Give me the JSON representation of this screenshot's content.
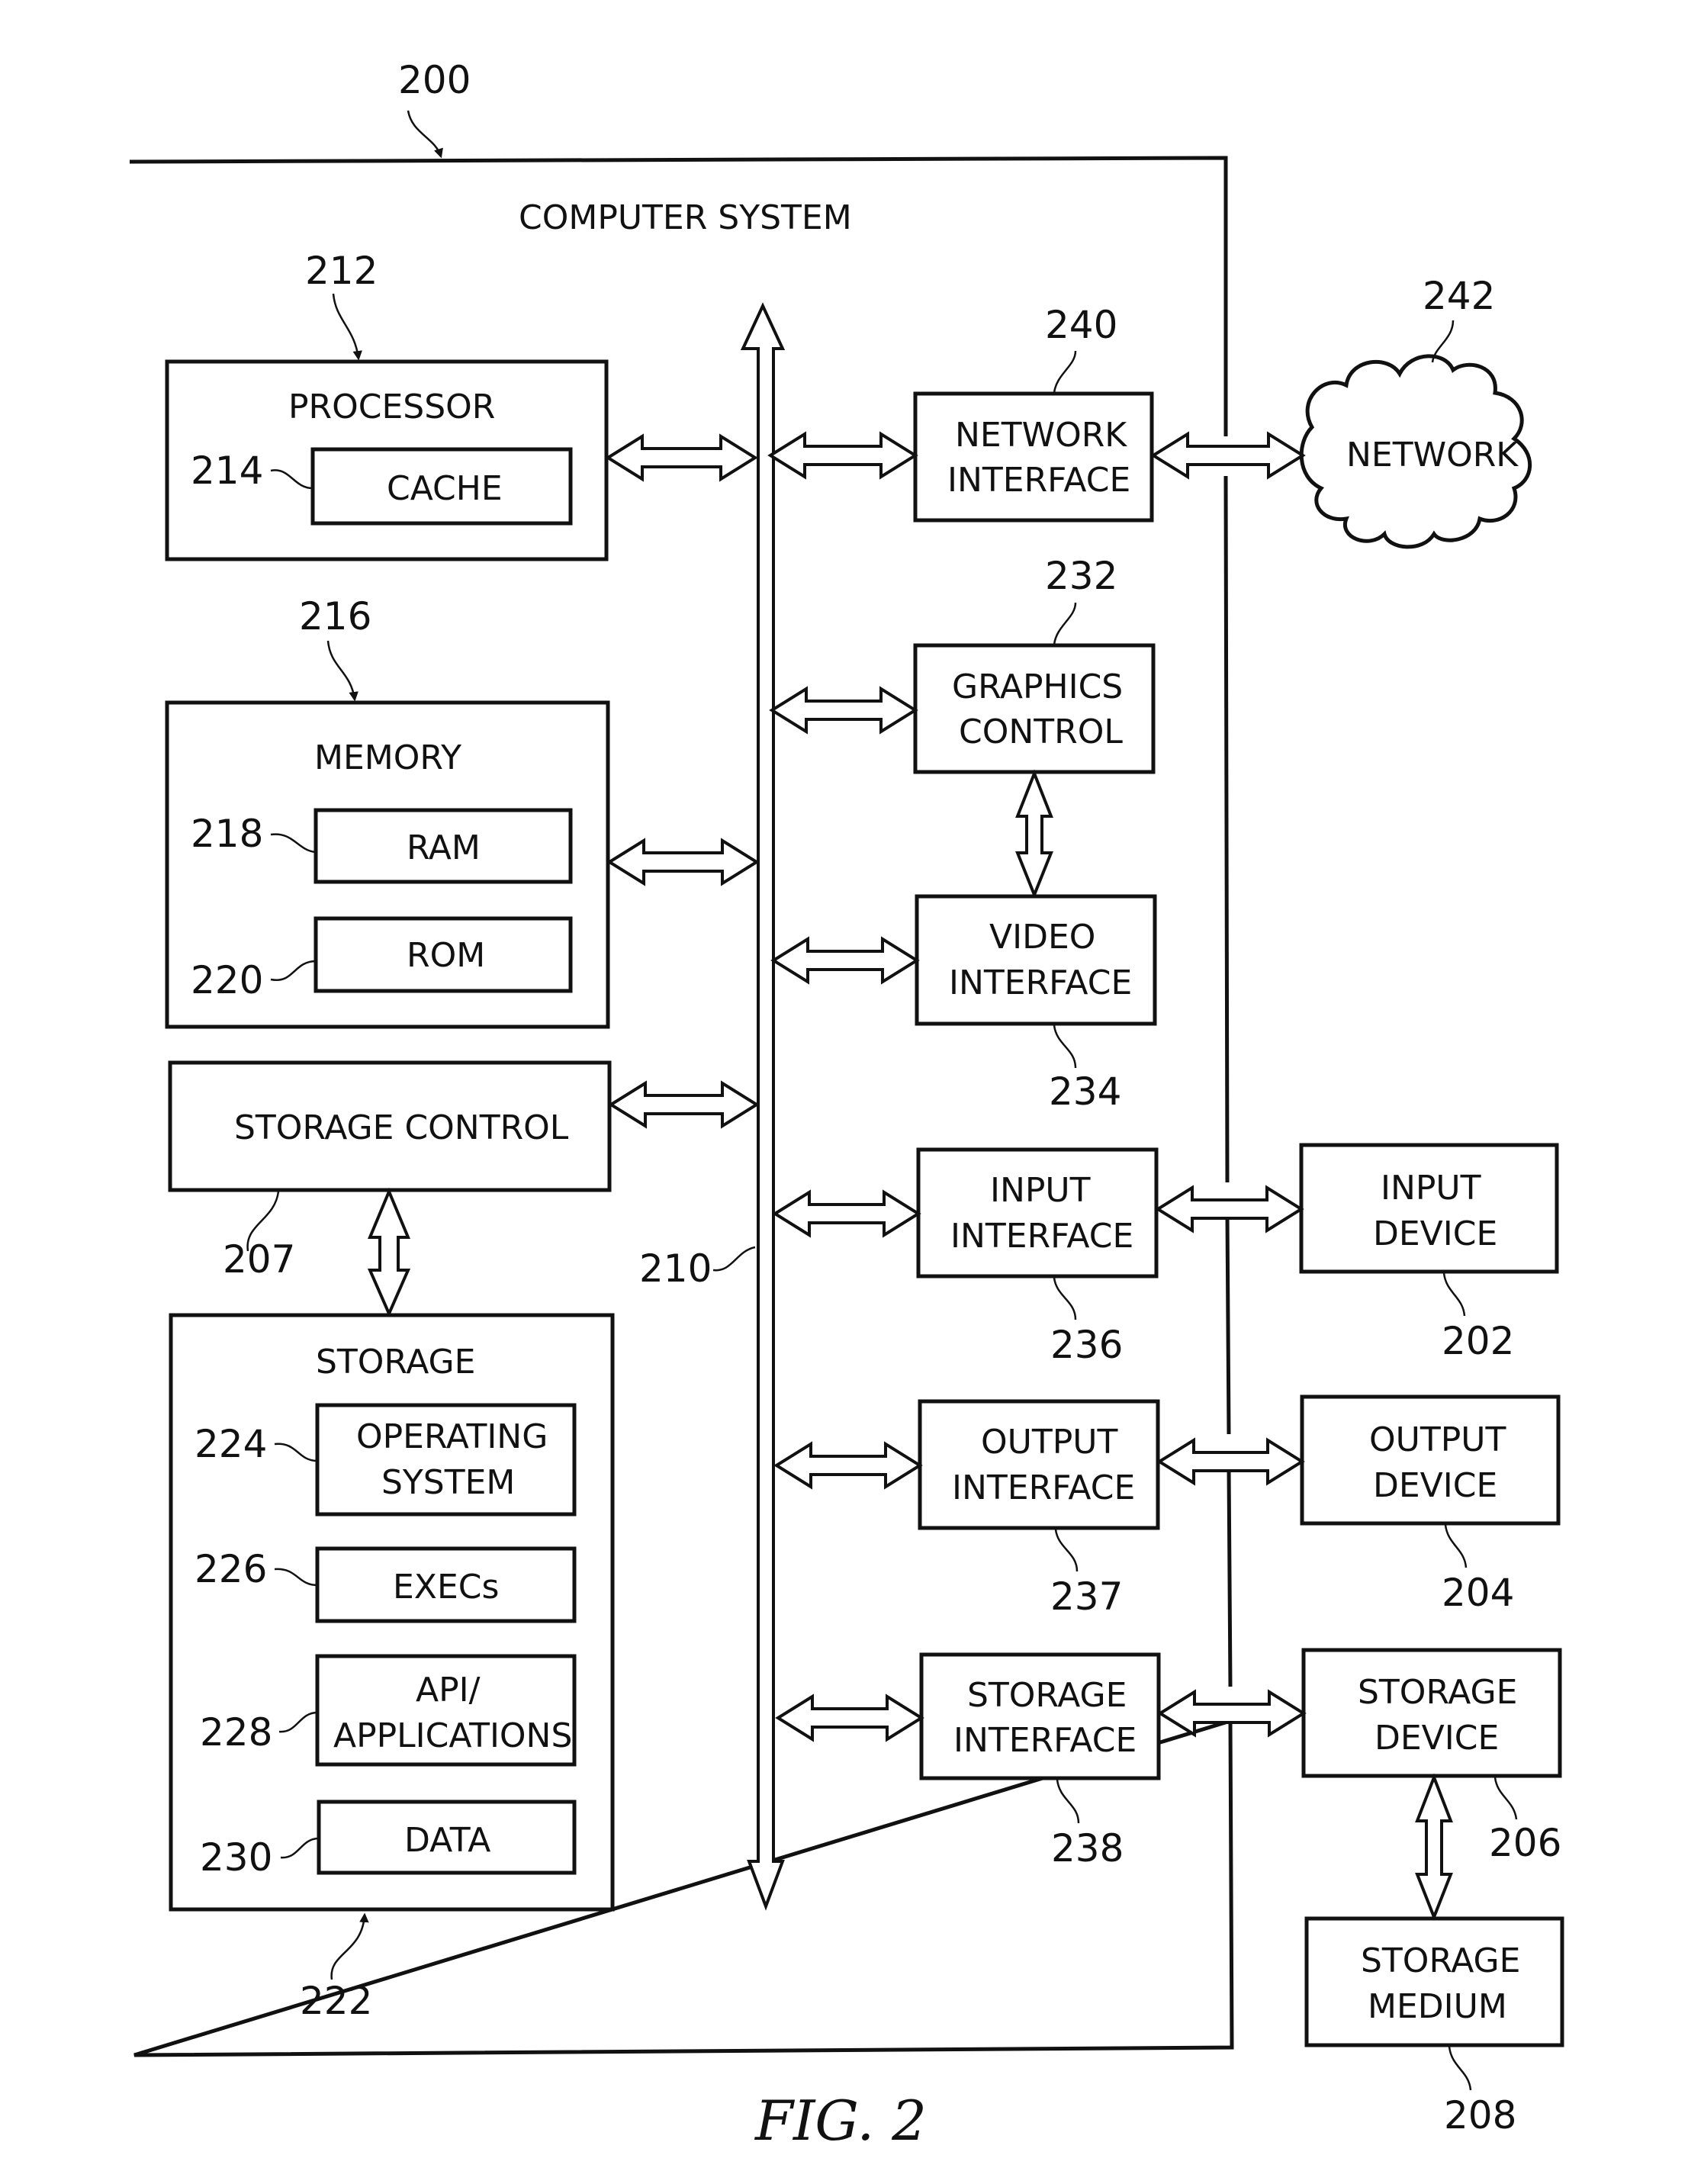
{
  "figure": {
    "caption": "FIG. 2",
    "system_ref": "200",
    "system_title": "COMPUTER SYSTEM",
    "bus_ref": "210"
  },
  "components": {
    "processor": {
      "ref": "212",
      "label": "PROCESSOR"
    },
    "cache": {
      "ref": "214",
      "label": "CACHE"
    },
    "memory": {
      "ref": "216",
      "label": "MEMORY"
    },
    "ram": {
      "ref": "218",
      "label": "RAM"
    },
    "rom": {
      "ref": "220",
      "label": "ROM"
    },
    "storage_control": {
      "ref": "207",
      "label": "STORAGE CONTROL"
    },
    "storage": {
      "ref": "222",
      "label": "STORAGE"
    },
    "operating_system": {
      "ref": "224",
      "label_line1": "OPERATING",
      "label_line2": "SYSTEM"
    },
    "execs": {
      "ref": "226",
      "label": "EXECs"
    },
    "api_applications": {
      "ref": "228",
      "label_line1": "API/",
      "label_line2": "APPLICATIONS"
    },
    "data": {
      "ref": "230",
      "label": "DATA"
    },
    "network_interface": {
      "ref": "240",
      "label_line1": "NETWORK",
      "label_line2": "INTERFACE"
    },
    "network": {
      "ref": "242",
      "label": "NETWORK"
    },
    "graphics_control": {
      "ref": "232",
      "label_line1": "GRAPHICS",
      "label_line2": "CONTROL"
    },
    "video_interface": {
      "ref": "234",
      "label_line1": "VIDEO",
      "label_line2": "INTERFACE"
    },
    "input_interface": {
      "ref": "236",
      "label_line1": "INPUT",
      "label_line2": "INTERFACE"
    },
    "output_interface": {
      "ref": "237",
      "label_line1": "OUTPUT",
      "label_line2": "INTERFACE"
    },
    "storage_interface": {
      "ref": "238",
      "label_line1": "STORAGE",
      "label_line2": "INTERFACE"
    },
    "input_device": {
      "ref": "202",
      "label_line1": "INPUT",
      "label_line2": "DEVICE"
    },
    "output_device": {
      "ref": "204",
      "label_line1": "OUTPUT",
      "label_line2": "DEVICE"
    },
    "storage_device": {
      "ref": "206",
      "label_line1": "STORAGE",
      "label_line2": "DEVICE"
    },
    "storage_medium": {
      "ref": "208",
      "label_line1": "STORAGE",
      "label_line2": "MEDIUM"
    }
  }
}
